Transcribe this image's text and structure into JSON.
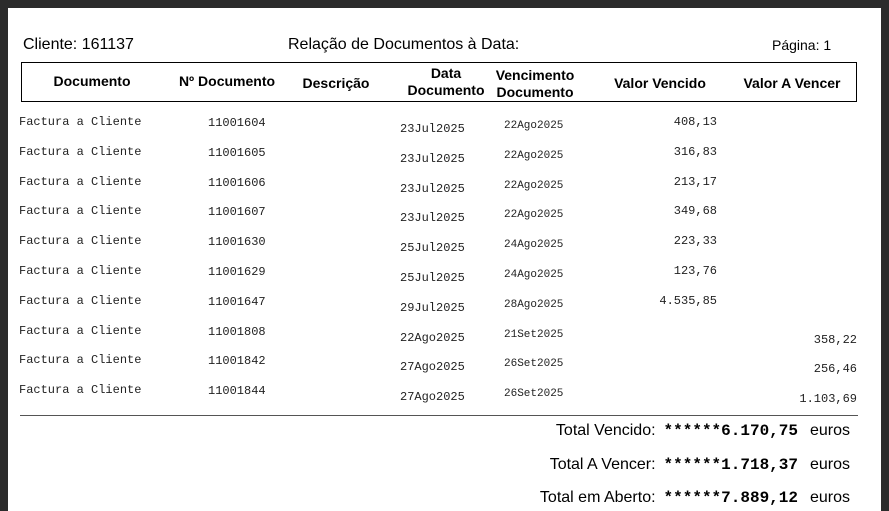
{
  "header": {
    "cliente": "Cliente: 161137",
    "title": "Relação de Documentos à Data:",
    "pagina": "Página: 1"
  },
  "columns": {
    "documento": "Documento",
    "n_documento": "Nº Documento",
    "descricao": "Descrição",
    "data_documento": [
      "Data",
      "Documento"
    ],
    "vencimento_documento": [
      "Vencimento",
      "Documento"
    ],
    "valor_vencido": "Valor Vencido",
    "valor_a_vencer": "Valor A Vencer"
  },
  "rows": [
    {
      "documento": "Factura a Cliente",
      "numero": "11001604",
      "data": "23Jul2025",
      "vencimento": "22Ago2025",
      "valor_vencido": "408,13",
      "valor_a_vencer": ""
    },
    {
      "documento": "Factura a Cliente",
      "numero": "11001605",
      "data": "23Jul2025",
      "vencimento": "22Ago2025",
      "valor_vencido": "316,83",
      "valor_a_vencer": ""
    },
    {
      "documento": "Factura a Cliente",
      "numero": "11001606",
      "data": "23Jul2025",
      "vencimento": "22Ago2025",
      "valor_vencido": "213,17",
      "valor_a_vencer": ""
    },
    {
      "documento": "Factura a Cliente",
      "numero": "11001607",
      "data": "23Jul2025",
      "vencimento": "22Ago2025",
      "valor_vencido": "349,68",
      "valor_a_vencer": ""
    },
    {
      "documento": "Factura a Cliente",
      "numero": "11001630",
      "data": "25Jul2025",
      "vencimento": "24Ago2025",
      "valor_vencido": "223,33",
      "valor_a_vencer": ""
    },
    {
      "documento": "Factura a Cliente",
      "numero": "11001629",
      "data": "25Jul2025",
      "vencimento": "24Ago2025",
      "valor_vencido": "123,76",
      "valor_a_vencer": ""
    },
    {
      "documento": "Factura a Cliente",
      "numero": "11001647",
      "data": "29Jul2025",
      "vencimento": "28Ago2025",
      "valor_vencido": "4.535,85",
      "valor_a_vencer": ""
    },
    {
      "documento": "Factura a Cliente",
      "numero": "11001808",
      "data": "22Ago2025",
      "vencimento": "21Set2025",
      "valor_vencido": "",
      "valor_a_vencer": "358,22"
    },
    {
      "documento": "Factura a Cliente",
      "numero": "11001842",
      "data": "27Ago2025",
      "vencimento": "26Set2025",
      "valor_vencido": "",
      "valor_a_vencer": "256,46"
    },
    {
      "documento": "Factura a Cliente",
      "numero": "11001844",
      "data": "27Ago2025",
      "vencimento": "26Set2025",
      "valor_vencido": "",
      "valor_a_vencer": "1.103,69"
    }
  ],
  "totals": [
    {
      "label": "Total Vencido:",
      "amount": "******6.170,75",
      "currency": "euros"
    },
    {
      "label": "Total A Vencer:",
      "amount": "******1.718,37",
      "currency": "euros"
    },
    {
      "label": "Total em Aberto:",
      "amount": "******7.889,12",
      "currency": "euros"
    }
  ]
}
